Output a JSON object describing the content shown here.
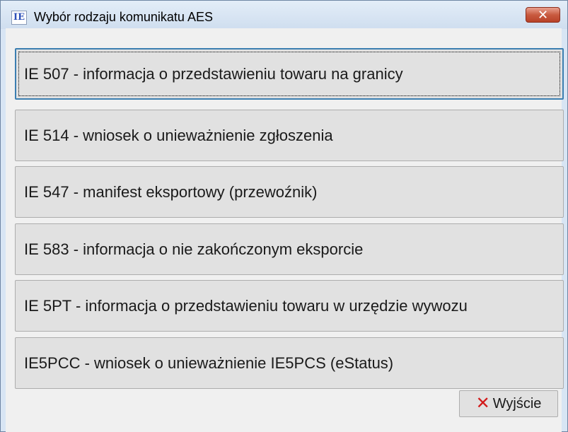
{
  "window": {
    "title": "Wybór rodzaju komunikatu AES",
    "icon_text": "IE",
    "close_symbol": "✕"
  },
  "messages": [
    {
      "label": "IE 507 - informacja o przedstawieniu towaru na granicy"
    },
    {
      "label": "IE 514 - wniosek o unieważnienie zgłoszenia"
    },
    {
      "label": "IE 547 - manifest eksportowy (przewoźnik)"
    },
    {
      "label": "IE 583 - informacja o nie zakończonym eksporcie"
    },
    {
      "label": "IE 5PT - informacja o przedstawieniu towaru w urzędzie wywozu"
    },
    {
      "label": "IE5PCC - wniosek o unieważnienie IE5PCS (eStatus)"
    }
  ],
  "footer": {
    "exit_label": "Wyjście",
    "exit_icon": "x-icon"
  },
  "colors": {
    "frame": "#d8e5f4",
    "client": "#f0f0f0",
    "button": "#e1e1e1",
    "focus": "#3c7fb1",
    "exit_icon": "#d21a1a"
  }
}
